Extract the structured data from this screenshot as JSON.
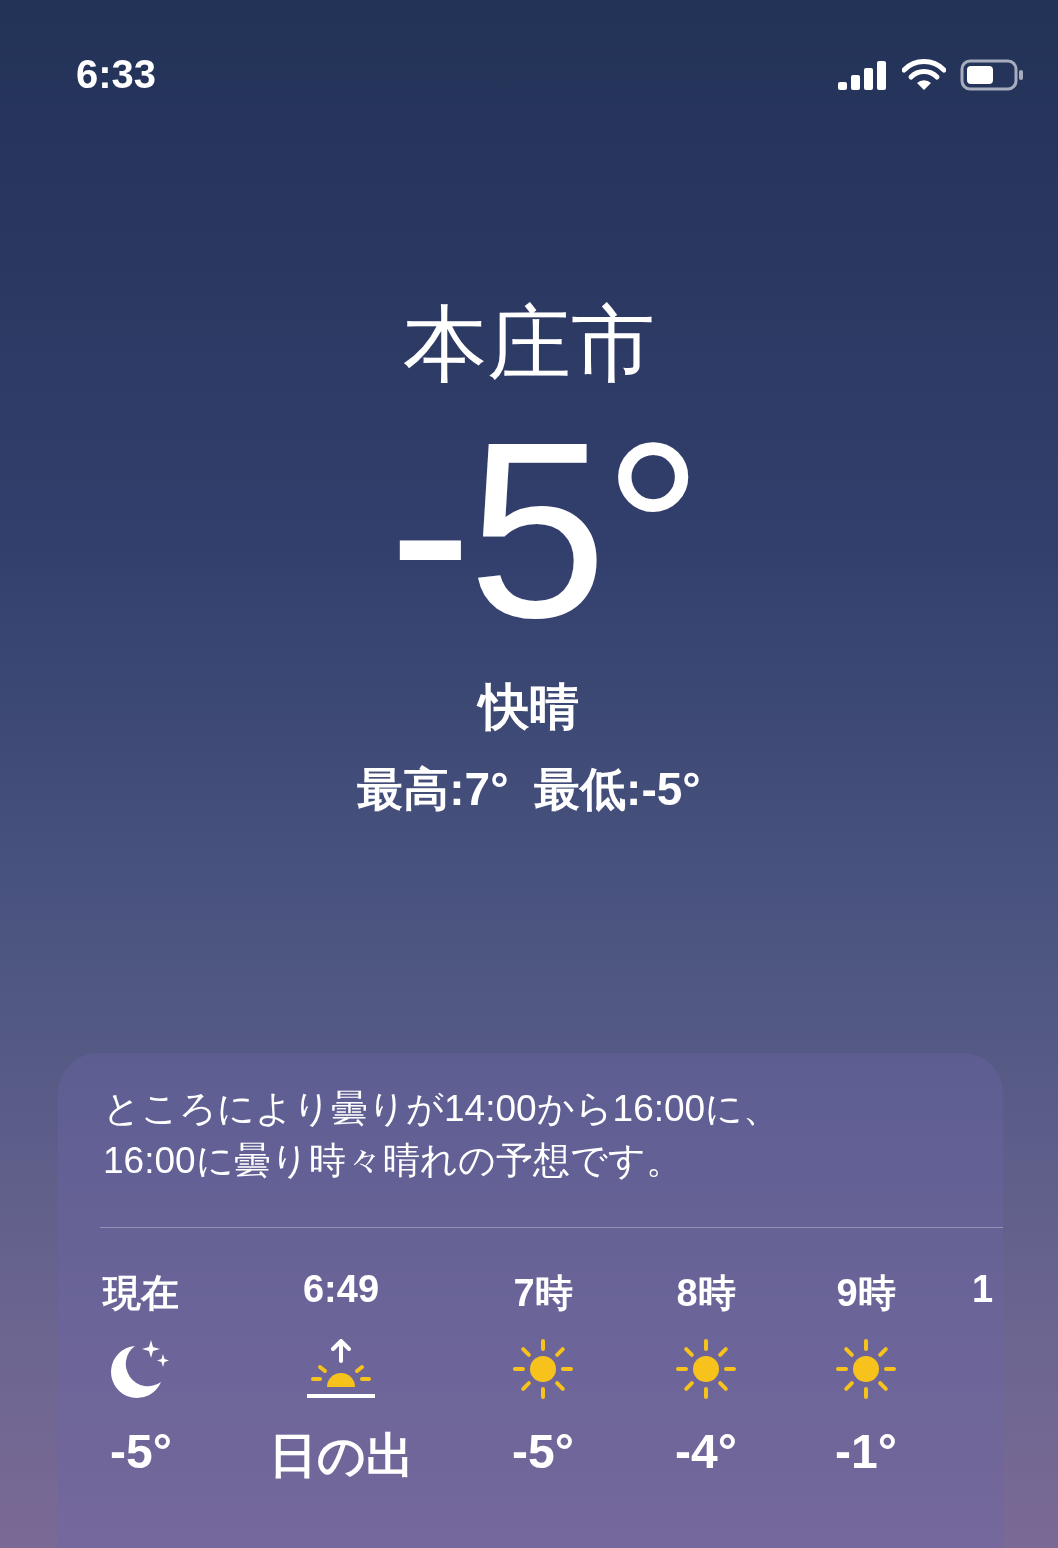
{
  "status_bar": {
    "time": "6:33"
  },
  "location": "本庄市",
  "temperature": "-5°",
  "condition": "快晴",
  "high_low": "最高:7°  最低:-5°",
  "forecast": {
    "summary": "ところにより曇りが14:00から16:00に、16:00に曇り時々晴れの予想です。",
    "hours": [
      {
        "label": "現在",
        "kind": "moon",
        "temp": "-5°"
      },
      {
        "label": "6:49",
        "kind": "sunrise",
        "temp": "日の出"
      },
      {
        "label": "7時",
        "kind": "sun",
        "temp": "-5°"
      },
      {
        "label": "8時",
        "kind": "sun",
        "temp": "-4°"
      },
      {
        "label": "9時",
        "kind": "sun",
        "temp": "-1°"
      },
      {
        "label": "1"
      }
    ]
  }
}
